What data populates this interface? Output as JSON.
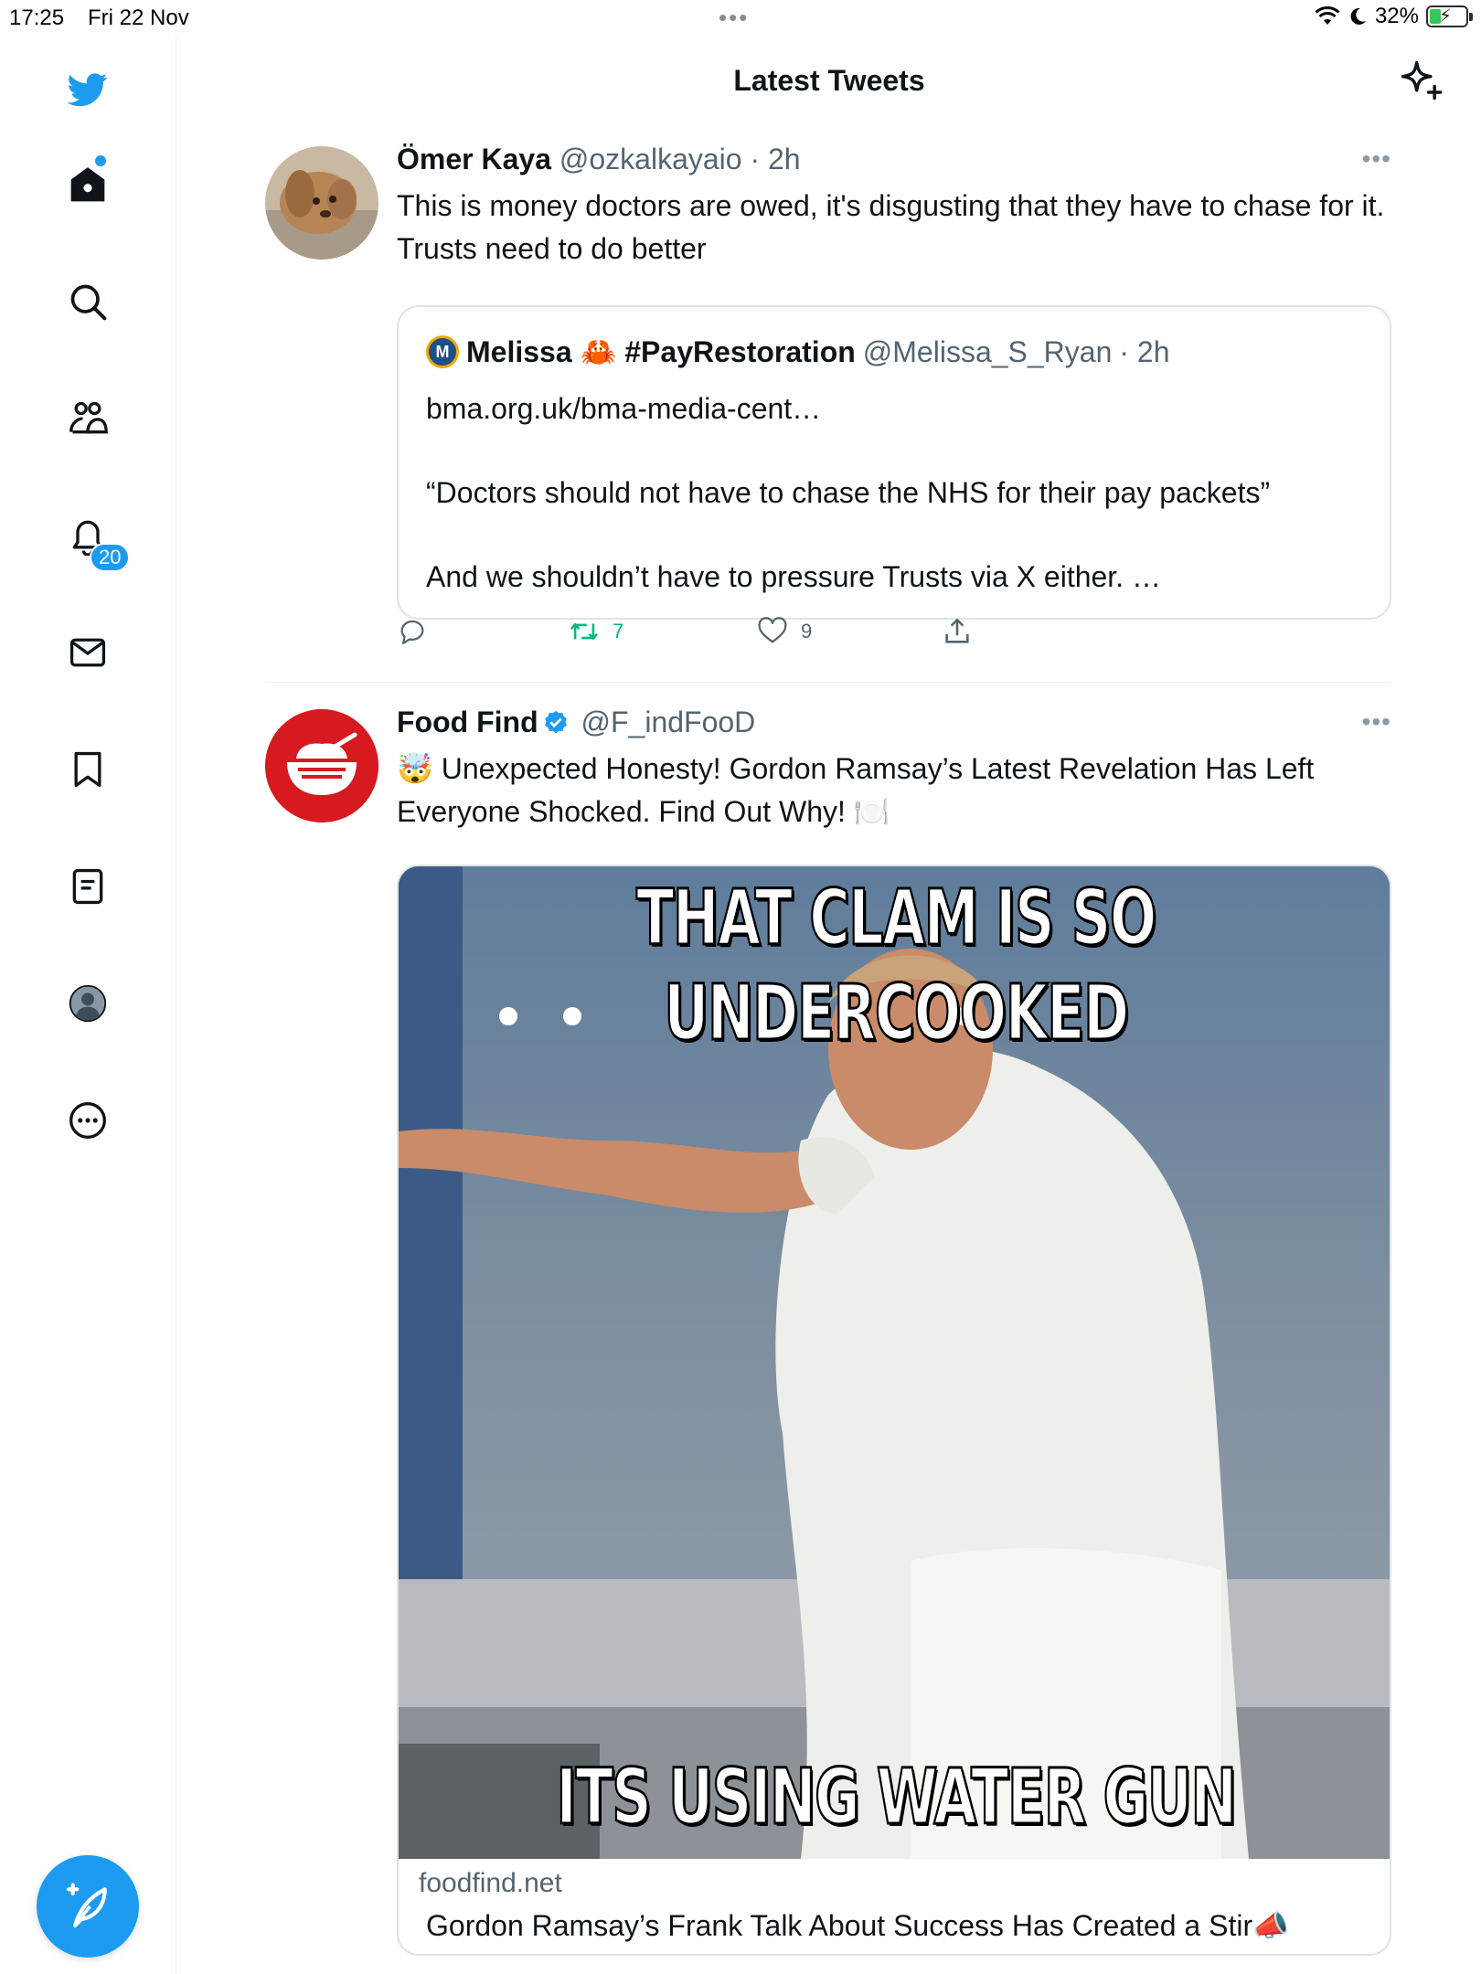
{
  "status_bar": {
    "time": "17:25",
    "date": "Fri 22 Nov",
    "battery_percent": "32%",
    "battery_level": 0.32,
    "icons": [
      "wifi-icon",
      "moon-icon",
      "battery-charging-icon"
    ]
  },
  "sidebar": {
    "items": [
      {
        "name": "twitter-logo-icon"
      },
      {
        "name": "home-icon",
        "has_dot": true
      },
      {
        "name": "search-icon"
      },
      {
        "name": "communities-icon"
      },
      {
        "name": "notifications-icon",
        "badge": "20"
      },
      {
        "name": "messages-icon"
      },
      {
        "name": "bookmarks-icon"
      },
      {
        "name": "lists-icon"
      },
      {
        "name": "profile-icon"
      },
      {
        "name": "more-icon"
      }
    ],
    "compose_icon": "compose-feather-icon",
    "accent": "#1d9bf0"
  },
  "header": {
    "title": "Latest Tweets",
    "sparkle_icon": "sparkle-icon"
  },
  "tweets": [
    {
      "name": "Ömer Kaya",
      "handle": "@ozkalkayaio",
      "time": "· 2h",
      "text": "This is money doctors are owed, it's disgusting that they have to chase for it. Trusts need to do better",
      "quote": {
        "avatar_letter": "M",
        "name": "Melissa 🦀 #PayRestoration",
        "handle": "@Melissa_S_Ryan",
        "time": "· 2h",
        "body": "bma.org.uk/bma-media-cent…\n\n“Doctors should not have to chase the NHS for their pay packets”\n\nAnd we shouldn’t have to pressure Trusts via X either. …"
      },
      "actions": {
        "reply_count": "",
        "retweet_count": "7",
        "like_count": "9"
      }
    },
    {
      "name": "Food Find",
      "handle": "@F_indFooD",
      "verified": true,
      "text": "🤯 Unexpected Honesty! Gordon Ramsay’s Latest Revelation Has Left Everyone Shocked. Find Out Why! 🍽️",
      "card": {
        "meme_top": "THAT CLAM IS SO UNDERCOOKED",
        "meme_bottom": "ITS USING WATER GUN",
        "domain": "foodfind.net",
        "title": "Gordon Ramsay’s Frank Talk About Success Has Created a Stir📣"
      }
    }
  ]
}
